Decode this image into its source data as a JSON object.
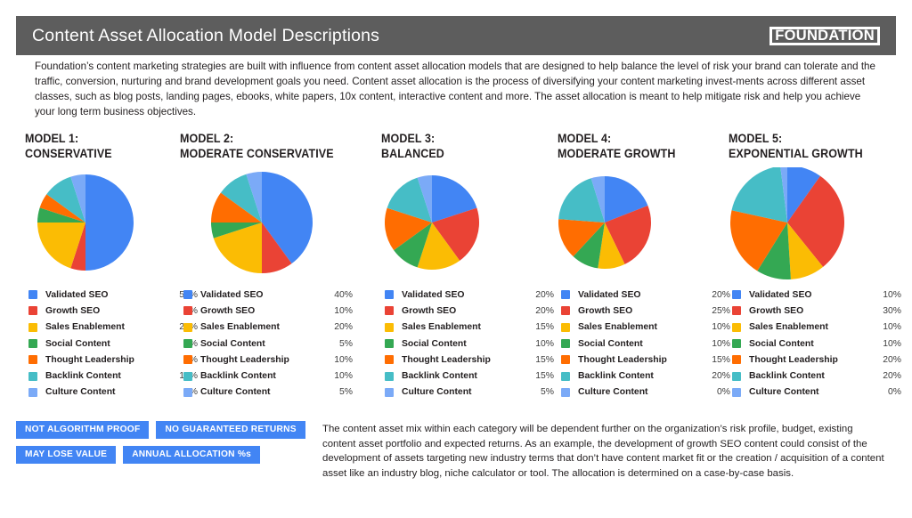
{
  "header": {
    "title": "Content Asset Allocation Model Descriptions",
    "logo_text": "FOUNDATION",
    "bar_color": "#5d5d5d"
  },
  "intro": "Foundation’s content marketing strategies are built with influence from content asset allocation models that are designed to help balance the level of risk your brand can tolerate and the traffic, conversion, nurturing and brand development goals you need. Content asset allocation is the process of diversifying your content marketing invest-ments across different asset classes, such as blog posts, landing pages, ebooks, white papers, 10x content, interactive content and more. The asset allocation is meant to help mitigate risk and help you achieve your long term business objectives.",
  "categories": [
    {
      "label": "Validated SEO",
      "color": "#4285f4"
    },
    {
      "label": "Growth SEO",
      "color": "#ea4335"
    },
    {
      "label": "Sales Enablement",
      "color": "#fbbc04"
    },
    {
      "label": "Social Content",
      "color": "#34a853"
    },
    {
      "label": "Thought Leadership",
      "color": "#ff6d01"
    },
    {
      "label": "Backlink Content",
      "color": "#46bdc6"
    },
    {
      "label": "Culture Content",
      "color": "#7baaf7"
    }
  ],
  "models": [
    {
      "title_line1": "MODEL 1:",
      "title_line2": "CONSERVATIVE",
      "values": [
        "50%",
        "5%",
        "20%",
        "5%",
        "5%",
        "10%",
        "5%"
      ],
      "pie_values": [
        50,
        5,
        20,
        5,
        5,
        10,
        5
      ],
      "pie_radius": 54
    },
    {
      "title_line1": "MODEL 2:",
      "title_line2": "MODERATE CONSERVATIVE",
      "values": [
        "40%",
        "10%",
        "20%",
        "5%",
        "10%",
        "10%",
        "5%"
      ],
      "pie_values": [
        40,
        10,
        20,
        5,
        10,
        10,
        5
      ],
      "pie_radius": 57
    },
    {
      "title_line1": "MODEL 3:",
      "title_line2": "BALANCED",
      "values": [
        "20%",
        "20%",
        "15%",
        "10%",
        "15%",
        "15%",
        "5%"
      ],
      "pie_values": [
        20,
        20,
        15,
        10,
        15,
        15,
        5
      ],
      "pie_radius": 53
    },
    {
      "title_line1": "MODEL 4:",
      "title_line2": "MODERATE GROWTH",
      "values": [
        "20%",
        "25%",
        "10%",
        "10%",
        "15%",
        "20%",
        "0%"
      ],
      "pie_values": [
        20,
        25,
        10,
        10,
        15,
        20,
        5
      ],
      "pie_radius": 52
    },
    {
      "title_line1": "MODEL 5:",
      "title_line2": "EXPONENTIAL GROWTH",
      "values": [
        "10%",
        "30%",
        "10%",
        "10%",
        "20%",
        "20%",
        "0%"
      ],
      "pie_values": [
        10,
        30,
        10,
        10,
        20,
        20,
        2
      ],
      "pie_radius": 64
    }
  ],
  "badges": [
    "NOT ALGORITHM PROOF",
    "NO GUARANTEED RETURNS",
    "MAY LOSE VALUE",
    "ANNUAL ALLOCATION %s"
  ],
  "badge_color": "#4285f4",
  "footnote": "The content asset mix within each category will be dependent further on the organization’s risk profile, budget, existing content asset portfolio and expected returns. As an example, the development of growth SEO content could consist of the development of assets targeting new industry terms that don’t have content market fit or the creation / acquisition of a content asset like an industry blog, niche calculator or tool. The allocation is determined on a case-by-case basis.",
  "chart_data": [
    {
      "type": "pie",
      "title": "MODEL 1: CONSERVATIVE",
      "categories": [
        "Validated SEO",
        "Growth SEO",
        "Sales Enablement",
        "Social Content",
        "Thought Leadership",
        "Backlink Content",
        "Culture Content"
      ],
      "values": [
        50,
        5,
        20,
        5,
        5,
        10,
        5
      ],
      "colors": [
        "#4285f4",
        "#ea4335",
        "#fbbc04",
        "#34a853",
        "#ff6d01",
        "#46bdc6",
        "#7baaf7"
      ],
      "unit": "%",
      "legend": "right",
      "start_angle": "12 o'clock, clockwise"
    },
    {
      "type": "pie",
      "title": "MODEL 2: MODERATE CONSERVATIVE",
      "categories": [
        "Validated SEO",
        "Growth SEO",
        "Sales Enablement",
        "Social Content",
        "Thought Leadership",
        "Backlink Content",
        "Culture Content"
      ],
      "values": [
        40,
        10,
        20,
        5,
        10,
        10,
        5
      ],
      "colors": [
        "#4285f4",
        "#ea4335",
        "#fbbc04",
        "#34a853",
        "#ff6d01",
        "#46bdc6",
        "#7baaf7"
      ],
      "unit": "%",
      "legend": "right",
      "start_angle": "12 o'clock, clockwise"
    },
    {
      "type": "pie",
      "title": "MODEL 3: BALANCED",
      "categories": [
        "Validated SEO",
        "Growth SEO",
        "Sales Enablement",
        "Social Content",
        "Thought Leadership",
        "Backlink Content",
        "Culture Content"
      ],
      "values": [
        20,
        20,
        15,
        10,
        15,
        15,
        5
      ],
      "colors": [
        "#4285f4",
        "#ea4335",
        "#fbbc04",
        "#34a853",
        "#ff6d01",
        "#46bdc6",
        "#7baaf7"
      ],
      "unit": "%",
      "legend": "right",
      "start_angle": "12 o'clock, clockwise"
    },
    {
      "type": "pie",
      "title": "MODEL 4: MODERATE GROWTH",
      "categories": [
        "Validated SEO",
        "Growth SEO",
        "Sales Enablement",
        "Social Content",
        "Thought Leadership",
        "Backlink Content",
        "Culture Content"
      ],
      "values": [
        20,
        25,
        10,
        10,
        15,
        20,
        0
      ],
      "colors": [
        "#4285f4",
        "#ea4335",
        "#fbbc04",
        "#34a853",
        "#ff6d01",
        "#46bdc6",
        "#7baaf7"
      ],
      "unit": "%",
      "legend": "right",
      "start_angle": "12 o'clock, clockwise"
    },
    {
      "type": "pie",
      "title": "MODEL 5: EXPONENTIAL GROWTH",
      "categories": [
        "Validated SEO",
        "Growth SEO",
        "Sales Enablement",
        "Social Content",
        "Thought Leadership",
        "Backlink Content",
        "Culture Content"
      ],
      "values": [
        10,
        30,
        10,
        10,
        20,
        20,
        0
      ],
      "colors": [
        "#4285f4",
        "#ea4335",
        "#fbbc04",
        "#34a853",
        "#ff6d01",
        "#46bdc6",
        "#7baaf7"
      ],
      "unit": "%",
      "legend": "right",
      "start_angle": "12 o'clock, clockwise"
    }
  ]
}
